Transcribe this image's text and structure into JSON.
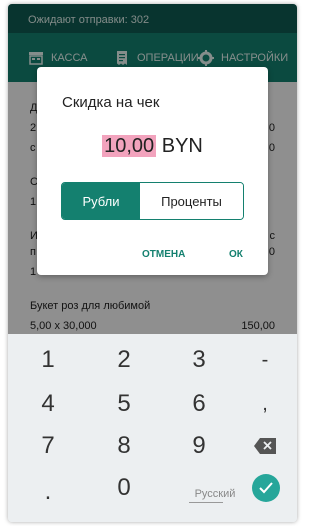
{
  "statusbar": {
    "text": "Ожидают отправки: 302"
  },
  "tabs": [
    {
      "label": "КАССА",
      "icon": "register-icon"
    },
    {
      "label": "ОПЕРАЦИИ",
      "icon": "receipt-icon"
    },
    {
      "label": "НАСТРОЙКИ",
      "icon": "gear-icon"
    }
  ],
  "content": {
    "item_name": "Букет роз для любимой",
    "item_qty_price": "5,00 x 30,000",
    "item_total": "150,00",
    "partial": {
      "l1": "Д",
      "l2": "2",
      "l3": "с",
      "l4": "С",
      "l5": "1",
      "l6": "И",
      "l7": "п",
      "l8": "1",
      "r1": "0",
      "r2": "0",
      "r3": "с",
      "r4": "0"
    }
  },
  "dialog": {
    "title": "Скидка на чек",
    "amount_value": "10,00",
    "currency": "BYN",
    "option_rubles": "Рубли",
    "option_percent": "Проценты",
    "cancel_label": "ОТМЕНА",
    "ok_label": "ОК"
  },
  "keyboard": {
    "keys": [
      "1",
      "2",
      "3",
      "-",
      "4",
      "5",
      "6",
      ",",
      "7",
      "8",
      "9",
      ".",
      "0"
    ],
    "language": "Русский"
  },
  "colors": {
    "primary": "#14806f",
    "status": "#0f5b51",
    "selection": "#f2a3bd",
    "enter": "#26a69a"
  }
}
